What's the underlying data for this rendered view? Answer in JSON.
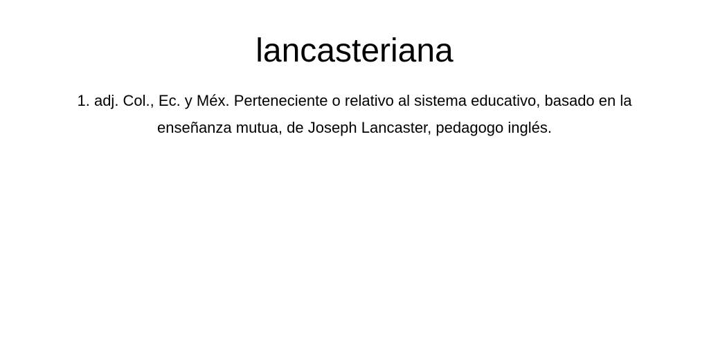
{
  "entry": {
    "headword": "lancasteriana",
    "definition": "1. adj. Col., Ec. y Méx. Perteneciente o relativo al sistema educativo, basado en la enseñanza mutua, de Joseph Lancaster, pedagogo inglés."
  }
}
